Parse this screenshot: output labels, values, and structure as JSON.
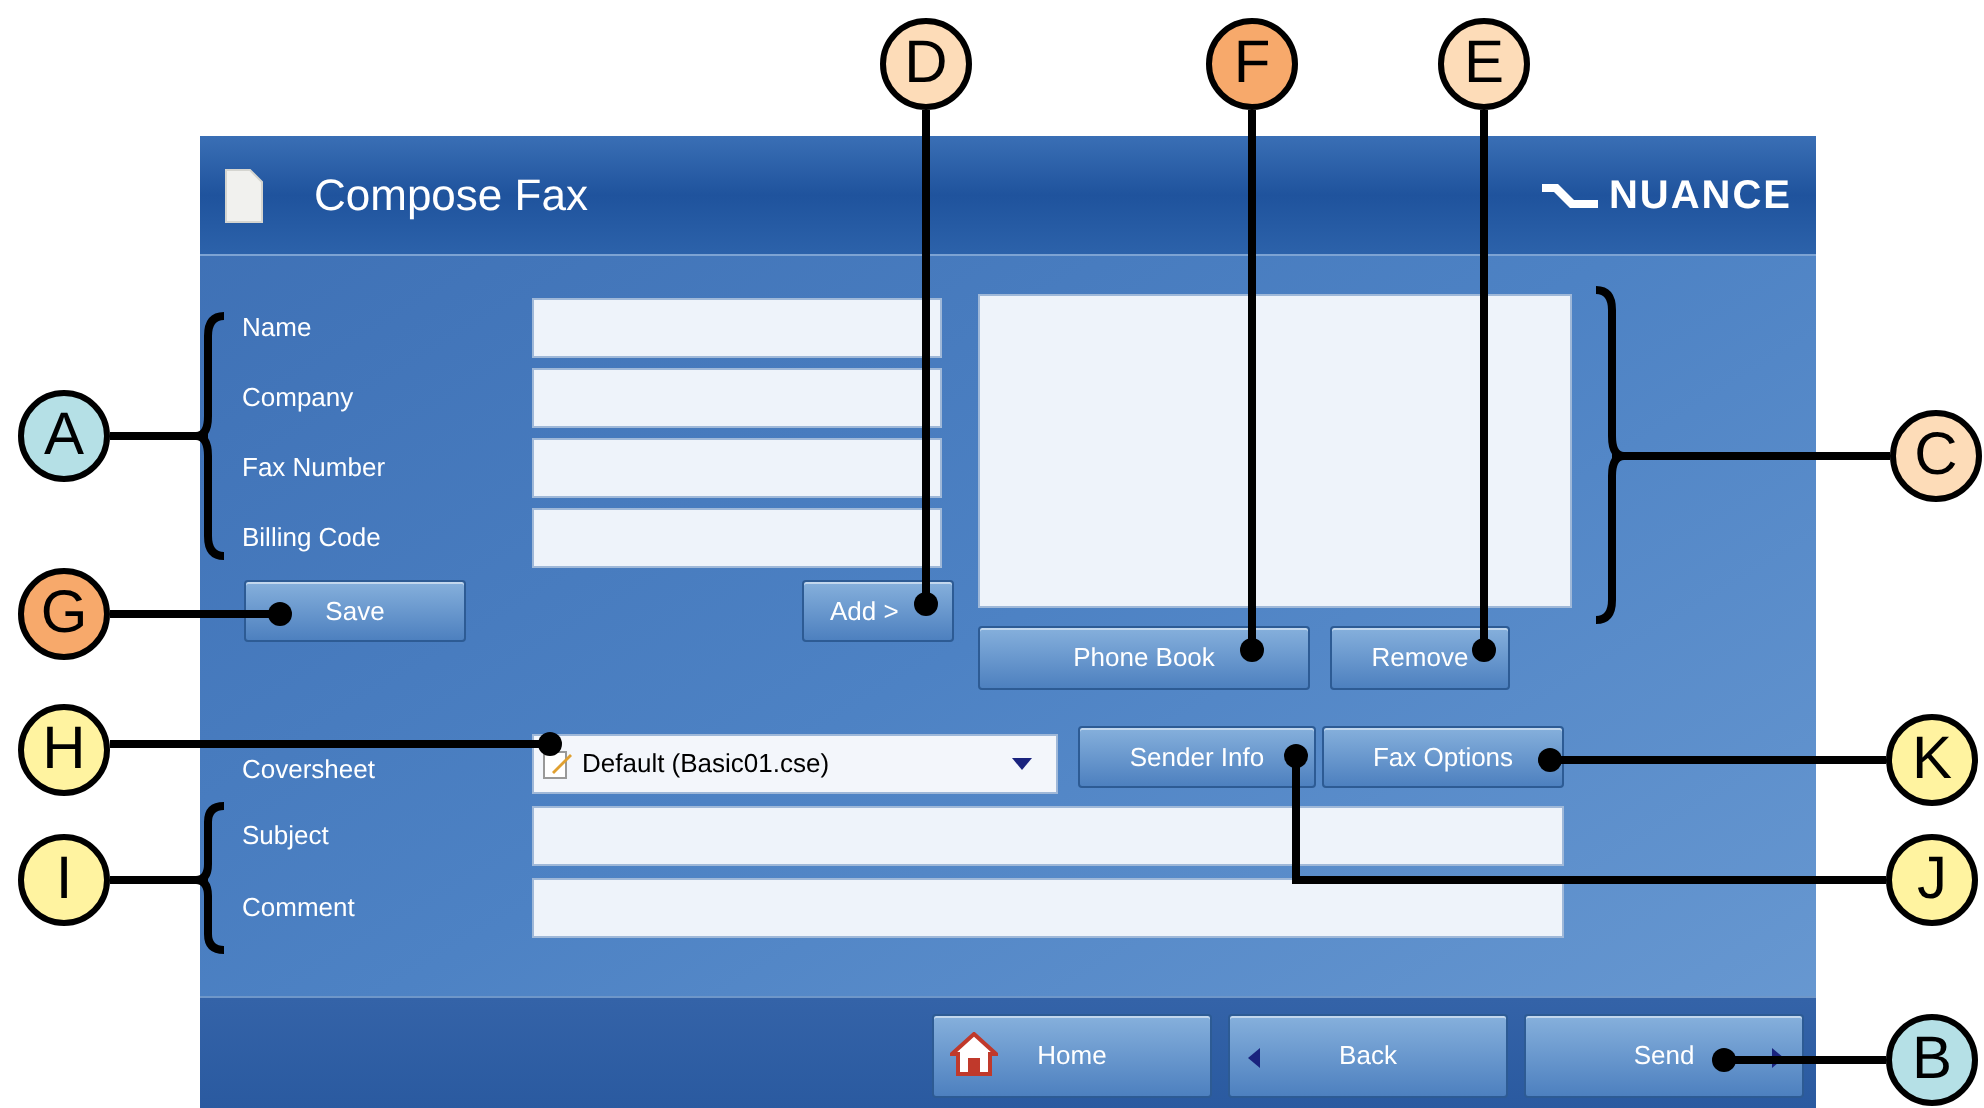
{
  "window": {
    "title": "Compose Fax",
    "logo": "NUANCE"
  },
  "recipient_fields": [
    {
      "label": "Name"
    },
    {
      "label": "Company"
    },
    {
      "label": "Fax Number"
    },
    {
      "label": "Billing Code"
    }
  ],
  "save_button": "Save",
  "add_button": "Add >",
  "recipient_list_buttons": [
    "Phone Book",
    "Remove"
  ],
  "coversheet": {
    "label": "Coversheet",
    "value": "Default (Basic01.cse)"
  },
  "coversheet_buttons": [
    "Sender Info",
    "Fax Options"
  ],
  "message_fields": [
    {
      "label": "Subject"
    },
    {
      "label": "Comment"
    }
  ],
  "footer_buttons": [
    {
      "label": "Home",
      "kind": "home"
    },
    {
      "label": "Back",
      "kind": "back"
    },
    {
      "label": "Send",
      "kind": "send"
    }
  ],
  "callouts": [
    {
      "label": "D",
      "color": "#fddcb8"
    },
    {
      "label": "F",
      "color": "#f7a96b"
    },
    {
      "label": "E",
      "color": "#fddcb8"
    },
    {
      "label": "A",
      "color": "#b5e0e6"
    },
    {
      "label": "C",
      "color": "#fddcb8"
    },
    {
      "label": "G",
      "color": "#f7a96b"
    },
    {
      "label": "H",
      "color": "#fff3a0"
    },
    {
      "label": "K",
      "color": "#fff3a0"
    },
    {
      "label": "I",
      "color": "#fff3a0"
    },
    {
      "label": "J",
      "color": "#fff3a0"
    },
    {
      "label": "B",
      "color": "#b5e0e6"
    }
  ]
}
